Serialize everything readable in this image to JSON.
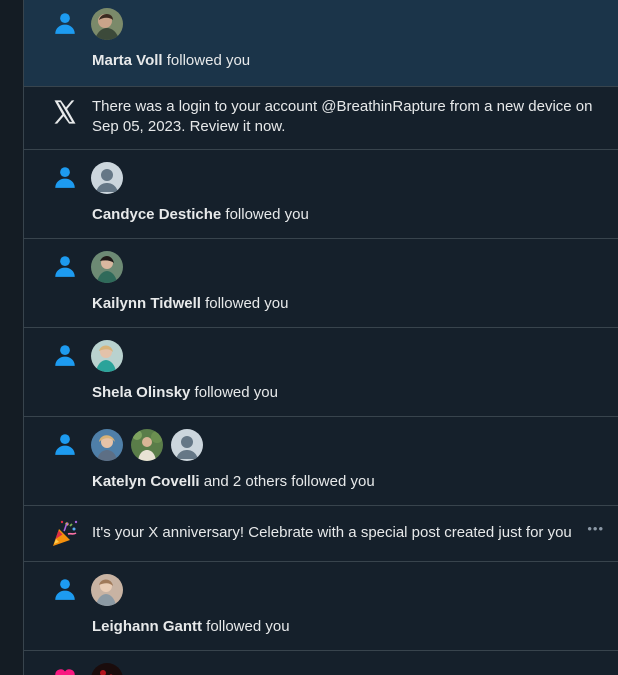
{
  "accent_color": "#1d9bf0",
  "notifications": [
    {
      "type": "follow",
      "name": "Marta Voll",
      "rest": " followed you"
    },
    {
      "type": "security",
      "message": "There was a login to your account @BreathinRapture from a new device on Sep 05, 2023. Review it now."
    },
    {
      "type": "follow",
      "name": "Candyce Destiche",
      "rest": " followed you"
    },
    {
      "type": "follow",
      "name": "Kailynn Tidwell",
      "rest": " followed you"
    },
    {
      "type": "follow",
      "name": "Shela Olinsky",
      "rest": " followed you"
    },
    {
      "type": "follow",
      "name": "Katelyn Covelli",
      "rest": " and 2 others followed you"
    },
    {
      "type": "anniversary",
      "message": "It's your X anniversary! Celebrate with a special post created just for you"
    },
    {
      "type": "follow",
      "name": "Leighann Gantt",
      "rest": " followed you"
    },
    {
      "type": "like"
    }
  ],
  "icons": {
    "follow": "person-icon",
    "security": "x-logo-icon",
    "anniversary": "party-popper-icon",
    "like": "heart-icon",
    "more": "more-icon"
  }
}
